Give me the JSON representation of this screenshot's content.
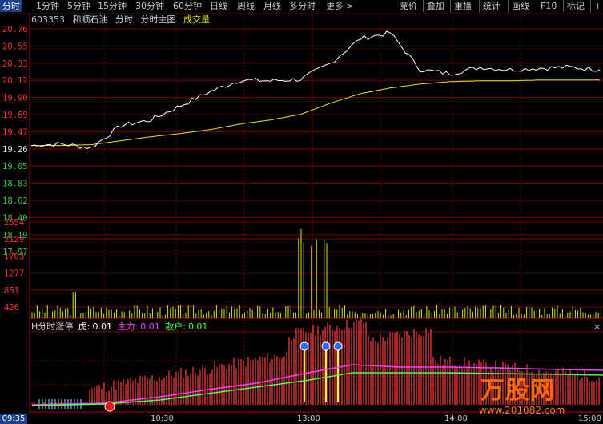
{
  "toolbar": {
    "tabs": [
      "分时",
      "1分钟",
      "5分钟",
      "15分钟",
      "30分钟",
      "60分钟",
      "日线",
      "周线",
      "月线",
      "多分时",
      "更多 >"
    ],
    "right_buttons": [
      "竞价",
      "叠加",
      "重播",
      "统计",
      "画线",
      "F10",
      "标记",
      "+自"
    ]
  },
  "title": {
    "code": "603353",
    "name": "和顺石油",
    "link1": "分时",
    "link2": "分时主图",
    "volume_label": "成交量"
  },
  "price_axis": {
    "labels": [
      "20.76",
      "20.55",
      "20.33",
      "20.12",
      "19.90",
      "19.69",
      "19.47",
      "19.26",
      "19.05",
      "18.83",
      "18.62",
      "18.40",
      "18.19",
      "17.97"
    ],
    "prev_close": "19.26"
  },
  "volume_axis": {
    "labels": [
      "2554",
      "2129",
      "1703",
      "1277",
      "851",
      "426"
    ]
  },
  "indicator": {
    "name": "H分时涨停",
    "tiger_label": "虎:",
    "tiger_value": "0.01",
    "main_label": "主力:",
    "main_value": "0.01",
    "retail_label": "散户:",
    "retail_value": "0.01",
    "close_glyph": "×"
  },
  "time_axis": {
    "start": "09:35",
    "ticks": [
      "10:30",
      "13:00",
      "14:00",
      "15:00"
    ]
  },
  "watermark": {
    "brand": "万股网",
    "url": "www.201082.com"
  },
  "colors": {
    "grid": "#7a0000",
    "price_line": "#ffffff",
    "avg_line": "#e6e600",
    "up_axis": "#ff3030",
    "down_axis": "#2ecc40",
    "volume_bar": "#e6e600",
    "indicator_bar": "#ff4040",
    "main_line": "#ff3cff",
    "retail_line": "#4cff4c"
  },
  "chart_data": [
    {
      "type": "line",
      "title": "",
      "xlabel": "",
      "ylabel": "",
      "ylim": [
        17.97,
        20.76
      ],
      "x": [
        "09:30",
        "09:35",
        "09:45",
        "10:00",
        "10:15",
        "10:30",
        "10:45",
        "11:00",
        "11:15",
        "11:30",
        "13:00",
        "13:10",
        "13:20",
        "13:30",
        "13:45",
        "14:00",
        "14:15",
        "14:30",
        "14:45",
        "15:00"
      ],
      "series": [
        {
          "values": [
            19.3,
            19.32,
            19.27,
            19.55,
            19.62,
            19.8,
            19.98,
            20.12,
            20.11,
            20.13,
            20.33,
            20.64,
            20.71,
            20.25,
            20.2,
            20.28,
            20.25,
            20.27,
            20.28,
            20.25
          ]
        },
        {
          "values": [
            19.3,
            19.3,
            19.31,
            19.36,
            19.41,
            19.45,
            19.5,
            19.57,
            19.62,
            19.69,
            19.83,
            19.95,
            20.02,
            20.07,
            20.1,
            20.11,
            20.11,
            20.12,
            20.12,
            20.12
          ]
        }
      ]
    },
    {
      "type": "bar",
      "title": "",
      "ylim": [
        0,
        2554
      ],
      "x": [
        "09:30",
        "10:30",
        "11:30",
        "13:00",
        "14:00",
        "15:00"
      ],
      "values": [
        850,
        430,
        620,
        2500,
        360,
        420
      ]
    }
  ]
}
